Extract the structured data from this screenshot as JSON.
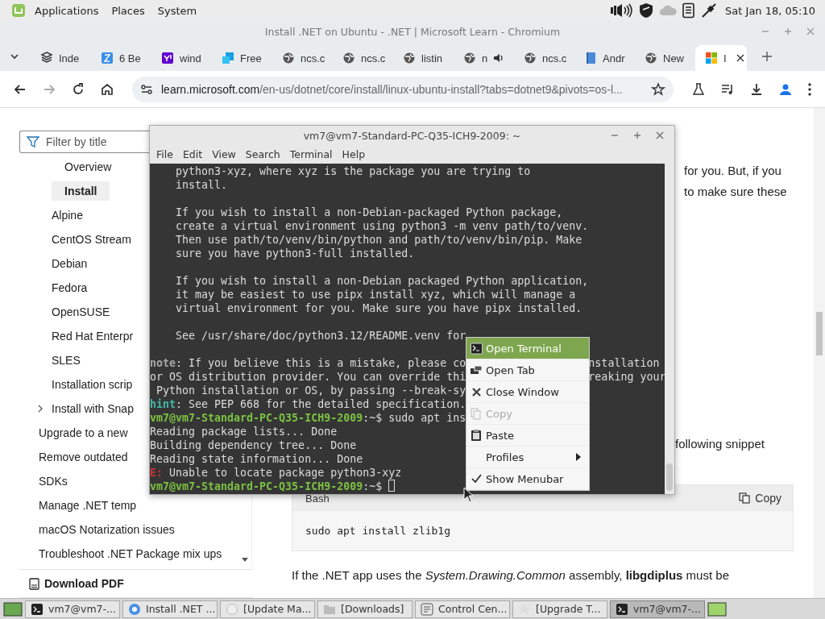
{
  "top_panel": {
    "menus": [
      "Applications",
      "Places",
      "System"
    ],
    "clock": "Sat Jan 18, 05:10"
  },
  "browser": {
    "title": "Install .NET on Ubuntu - .NET | Microsoft Learn - Chromium",
    "tabs": [
      {
        "title": "Inde",
        "kind": "stack",
        "audio": false,
        "selected": false
      },
      {
        "title": "6 Be",
        "kind": "app",
        "audio": false,
        "selected": false
      },
      {
        "title": "wind",
        "kind": "purple",
        "audio": false,
        "selected": false
      },
      {
        "title": "Free",
        "kind": "tiles",
        "audio": false,
        "selected": false
      },
      {
        "title": "ncs.c",
        "kind": "globe",
        "audio": false,
        "selected": false
      },
      {
        "title": "ncs.c",
        "kind": "globe",
        "audio": false,
        "selected": false
      },
      {
        "title": "listin",
        "kind": "globe",
        "audio": false,
        "selected": false
      },
      {
        "title": "n",
        "kind": "globe",
        "audio": true,
        "selected": false
      },
      {
        "title": "ncs.c",
        "kind": "globe",
        "audio": false,
        "selected": false
      },
      {
        "title": "Andr",
        "kind": "book",
        "audio": false,
        "selected": false
      },
      {
        "title": "New",
        "kind": "globe",
        "audio": false,
        "selected": false
      },
      {
        "title": "I",
        "kind": "windows",
        "audio": false,
        "selected": true
      }
    ],
    "address": {
      "host": "learn.microsoft.com",
      "path": "/en-us/dotnet/core/install/linux-ubuntu-install?tabs=dotnet9&pivots=os-l..."
    }
  },
  "sidebar": {
    "filter_placeholder": "Filter by title",
    "items": [
      {
        "children": [
          {
            "children": [
              {
                "label": "Overview",
                "selected": false
              },
              {
                "label": "Install",
                "selected": true
              }
            ]
          },
          {
            "label": "Alpine",
            "selected": false
          },
          {
            "label": "CentOS Stream",
            "selected": false
          },
          {
            "label": "Debian",
            "selected": false
          },
          {
            "label": "Fedora",
            "selected": false
          },
          {
            "label": "OpenSUSE",
            "selected": false
          },
          {
            "label": "Red Hat Enterpr",
            "selected": false
          },
          {
            "label": "SLES",
            "selected": false
          },
          {
            "label": "Installation scrip",
            "selected": false
          },
          {
            "label": "Install with Snap",
            "selected": false,
            "expanded": false
          }
        ]
      },
      {
        "label": "Upgrade to a new",
        "selected": false
      },
      {
        "label": "Remove outdated",
        "selected": false
      },
      {
        "label": "SDKs",
        "selected": false
      },
      {
        "label": "Manage .NET temp",
        "selected": false
      },
      {
        "label": "macOS Notarization issues",
        "selected": false
      },
      {
        "label": "Troubleshoot .NET Package mix ups",
        "selected": false
      }
    ],
    "download": "Download PDF"
  },
  "article": {
    "fragments": [
      "for you. But, if you",
      "to make sure these"
    ],
    "fragment_2": "following snippet",
    "code": {
      "language": "Bash",
      "copy": "Copy",
      "text": "sudo apt install zlib1g"
    },
    "paragraph": "If the .NET app uses the *System.Drawing.Common* assembly, **libgdiplus** must be"
  },
  "terminal": {
    "title": "vm7@vm7-Standard-PC-Q35-ICH9-2009: ~",
    "menus": [
      "File",
      "Edit",
      "View",
      "Search",
      "Terminal",
      "Help"
    ],
    "lines": [
      {
        "kind": "text",
        "text": "    python3-xyz, where xyz is the package you are trying to"
      },
      {
        "kind": "text",
        "text": "    install."
      },
      {
        "kind": "blank"
      },
      {
        "kind": "text",
        "text": "    If you wish to install a non-Debian-packaged Python package,"
      },
      {
        "kind": "text",
        "text": "    create a virtual environment using python3 -m venv path/to/venv."
      },
      {
        "kind": "text",
        "text": "    Then use path/to/venv/bin/python and path/to/venv/bin/pip. Make"
      },
      {
        "kind": "text",
        "text": "    sure you have python3-full installed."
      },
      {
        "kind": "blank"
      },
      {
        "kind": "text",
        "text": "    If you wish to install a non-Debian packaged Python application,"
      },
      {
        "kind": "text",
        "text": "    it may be easiest to use pipx install xyz, which will manage a"
      },
      {
        "kind": "text",
        "text": "    virtual environment for you. Make sure you have pipx installed."
      },
      {
        "kind": "blank"
      },
      {
        "kind": "text",
        "text": "    See /usr/share/doc/python3.12/README.venv for"
      },
      {
        "kind": "blank"
      },
      {
        "kind": "note",
        "label": "note",
        "text": ": If you believe this is a mistake, please co",
        "tail": "nstallation"
      },
      {
        "kind": "text",
        "text": "or OS distribution provider. You can override thi",
        "tail": "reaking your"
      },
      {
        "kind": "text",
        "text": " Python installation or OS, by passing --break-sy"
      },
      {
        "kind": "hint",
        "label": "hint",
        "text": ": See PEP 668 for the detailed specification."
      },
      {
        "kind": "prompt",
        "host": "vm7@vm7-Standard-PC-Q35-ICH9-2009",
        "text": ":~$ sudo apt ins"
      },
      {
        "kind": "text",
        "text": "Reading package lists... Done"
      },
      {
        "kind": "text",
        "text": "Building dependency tree... Done"
      },
      {
        "kind": "text",
        "text": "Reading state information... Done"
      },
      {
        "kind": "error",
        "label": "E:",
        "text": " Unable to locate package python3-xyz"
      },
      {
        "kind": "prompt",
        "host": "vm7@vm7-Standard-PC-Q35-ICH9-2009",
        "text": ":~$ ",
        "cursor": true
      }
    ],
    "context_menu": [
      {
        "label": "Open Terminal",
        "kind": "terminal",
        "selected": true,
        "disabled": false
      },
      {
        "label": "Open Tab",
        "kind": "tab",
        "selected": false,
        "disabled": false
      },
      {
        "label": "Close Window",
        "kind": "close",
        "selected": false,
        "disabled": false
      },
      {
        "label": "Copy",
        "kind": "copy",
        "selected": false,
        "disabled": true
      },
      {
        "label": "Paste",
        "kind": "paste",
        "selected": false,
        "disabled": false
      },
      {
        "label": "Profiles",
        "kind": "submenu",
        "selected": false,
        "disabled": false
      },
      {
        "label": "Show Menubar",
        "kind": "check",
        "checked": true,
        "selected": false,
        "disabled": false
      }
    ]
  },
  "taskbar": [
    {
      "label": "vm7@vm7-...",
      "kind": "terminal",
      "selected": false
    },
    {
      "label": "Install .NET ...",
      "kind": "chromium",
      "selected": false
    },
    {
      "label": "[Update Ma...",
      "kind": "circle",
      "selected": false
    },
    {
      "label": "[Downloads]",
      "kind": "folder",
      "selected": false
    },
    {
      "label": "Control Cen...",
      "kind": "panel",
      "selected": false
    },
    {
      "label": "[Upgrade T...",
      "kind": "star",
      "selected": false
    },
    {
      "label": "vm7@vm7-...",
      "kind": "terminal",
      "selected": true
    }
  ]
}
